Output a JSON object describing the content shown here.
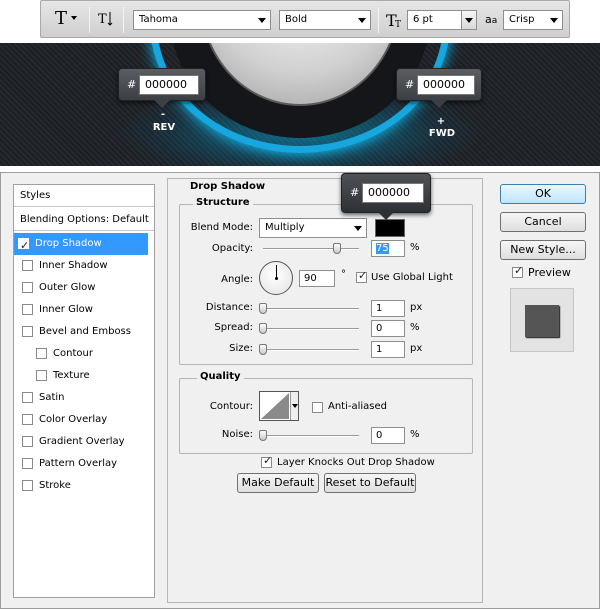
{
  "toolbar": {
    "font_family": "Tahoma",
    "font_style": "Bold",
    "font_size": "6 pt",
    "antialias_prefix": "a",
    "antialias_prefix2": "a",
    "antialias": "Crisp",
    "type_tool_glyph": "T",
    "size_glyph": "T"
  },
  "hero": {
    "left_badge": {
      "hash": "#",
      "value": "000000"
    },
    "right_badge": {
      "hash": "#",
      "value": "000000"
    },
    "rev_symbol": "-",
    "rev_label": "REV",
    "fwd_symbol": "+",
    "fwd_label": "FWD",
    "ring_color": "#17a6dd"
  },
  "dialog": {
    "styles_header": "Styles",
    "blending_options": "Blending Options: Default",
    "style_items": [
      {
        "label": "Drop Shadow",
        "checked": true,
        "selected": true
      },
      {
        "label": "Inner Shadow",
        "checked": false
      },
      {
        "label": "Outer Glow",
        "checked": false
      },
      {
        "label": "Inner Glow",
        "checked": false
      },
      {
        "label": "Bevel and Emboss",
        "checked": false
      },
      {
        "label": "Contour",
        "checked": false
      },
      {
        "label": "Texture",
        "checked": false
      },
      {
        "label": "Satin",
        "checked": false
      },
      {
        "label": "Color Overlay",
        "checked": false
      },
      {
        "label": "Gradient Overlay",
        "checked": false
      },
      {
        "label": "Pattern Overlay",
        "checked": false
      },
      {
        "label": "Stroke",
        "checked": false
      }
    ],
    "section_title": "Drop Shadow",
    "structure": {
      "title": "Structure",
      "blend_mode_label": "Blend Mode:",
      "blend_mode": "Multiply",
      "color": "#000000",
      "opacity_label": "Opacity:",
      "opacity": "75",
      "opacity_unit": "%",
      "angle_label": "Angle:",
      "angle": "90",
      "angle_unit": "°",
      "global_light_label": "Use Global Light",
      "global_light": true,
      "distance_label": "Distance:",
      "distance": "1",
      "distance_unit": "px",
      "spread_label": "Spread:",
      "spread": "0",
      "spread_unit": "%",
      "size_label": "Size:",
      "size": "1",
      "size_unit": "px"
    },
    "quality": {
      "title": "Quality",
      "contour_label": "Contour:",
      "anti_aliased_label": "Anti-aliased",
      "anti_aliased": false,
      "noise_label": "Noise:",
      "noise": "0",
      "noise_unit": "%"
    },
    "knockout_label": "Layer Knocks Out Drop Shadow",
    "knockout": true,
    "make_default": "Make Default",
    "reset_default": "Reset to Default",
    "color_badge": {
      "hash": "#",
      "value": "000000"
    },
    "ok": "OK",
    "cancel": "Cancel",
    "new_style": "New Style...",
    "preview_label": "Preview",
    "preview": true
  }
}
